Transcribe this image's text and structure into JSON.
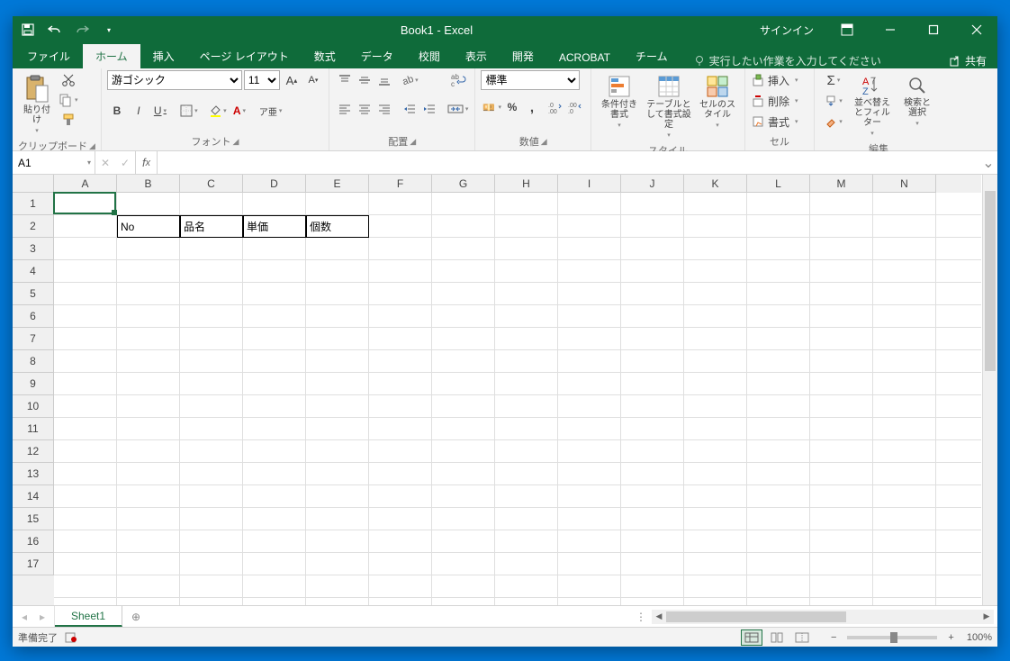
{
  "app": {
    "title": "Book1  -  Excel",
    "signin": "サインイン"
  },
  "tabs": [
    "ファイル",
    "ホーム",
    "挿入",
    "ページ レイアウト",
    "数式",
    "データ",
    "校閲",
    "表示",
    "開発",
    "ACROBAT",
    "チーム"
  ],
  "active_tab": 1,
  "tellme": "実行したい作業を入力してください",
  "share": "共有",
  "ribbon": {
    "clipboard": {
      "label": "クリップボード",
      "paste": "貼り付け"
    },
    "font": {
      "label": "フォント",
      "name": "游ゴシック",
      "size": "11",
      "ruby": "ア亜"
    },
    "align": {
      "label": "配置"
    },
    "number": {
      "label": "数値",
      "format": "標準"
    },
    "styles": {
      "label": "スタイル",
      "cond": "条件付き書式",
      "tbl": "テーブルとして書式設定",
      "cell": "セルのスタイル"
    },
    "cells": {
      "label": "セル",
      "insert": "挿入",
      "delete": "削除",
      "format": "書式"
    },
    "editing": {
      "label": "編集",
      "sort": "並べ替えとフィルター",
      "find": "検索と選択"
    },
    "wrap": "折り返し"
  },
  "namebox": "A1",
  "columns": [
    "A",
    "B",
    "C",
    "D",
    "E",
    "F",
    "G",
    "H",
    "I",
    "J",
    "K",
    "L",
    "M",
    "N"
  ],
  "rows": [
    "1",
    "2",
    "3",
    "4",
    "5",
    "6",
    "7",
    "8",
    "9",
    "10",
    "11",
    "12",
    "13",
    "14",
    "15",
    "16",
    "17"
  ],
  "cells": {
    "B2": "No",
    "C2": "品名",
    "D2": "単価",
    "E2": "個数"
  },
  "selected_cell": "A1",
  "sheet": {
    "name": "Sheet1"
  },
  "status": {
    "ready": "準備完了",
    "zoom": "100%"
  }
}
